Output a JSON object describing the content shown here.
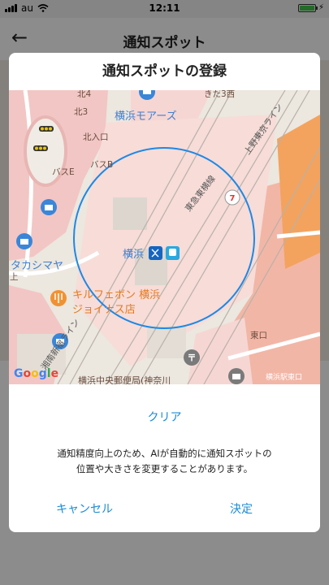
{
  "status_bar": {
    "carrier": "au",
    "time": "12:11"
  },
  "nav": {
    "back_icon": "arrow-left-icon",
    "title": "通知スポット"
  },
  "dialog": {
    "title": "通知スポットの登録",
    "map": {
      "labels": {
        "north4": "北4",
        "kita_sanjyo": "きた3西",
        "yokohama_more": "横浜モアーズ",
        "north3": "北3",
        "north_entrance": "北入口",
        "toyoko_line": "東急東横線",
        "ueno_tokyo_line": "上野東京ライン",
        "bus_b": "バスB",
        "bus_e": "バスE",
        "takashimaya": "タカシマヤ",
        "yokohama": "横浜",
        "kirufebon": "キルフェボン 横浜",
        "joinus": "ジョイナス店",
        "east_exit": "東口",
        "shonan_line": "湘南新宿ライン",
        "post_office": "横浜中央郵便局(神奈川",
        "yokohama_east": "横浜駅東口",
        "google": "Google",
        "side_ue": "上"
      },
      "accent": "#1e88e5"
    },
    "clear_label": "クリア",
    "note_line1": "通知精度向上のため、AIが自動的に通知スポットの",
    "note_line2": "位置や大きさを変更することがあります。",
    "cancel_label": "キャンセル",
    "ok_label": "決定"
  }
}
